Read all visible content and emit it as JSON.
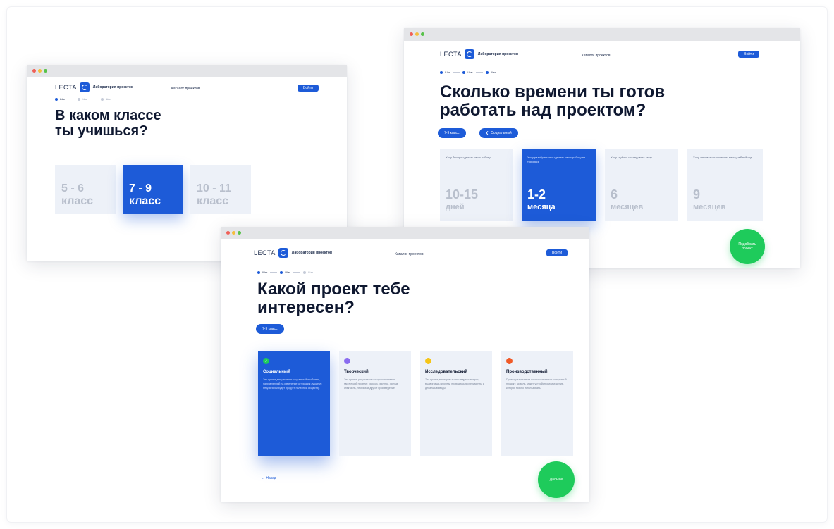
{
  "brand": {
    "logo_text": "LECTA",
    "lab_title": "Лаборатория проектов"
  },
  "nav": {
    "catalog_label": "Каталог проектов",
    "enter_label": "Войти"
  },
  "steps": [
    "Шаг",
    "Шаг",
    "Шаг"
  ],
  "window_grade": {
    "title_line1": "В каком классе",
    "title_line2": "ты учишься?",
    "options": [
      {
        "range": "5 - 6",
        "unit": "класс"
      },
      {
        "range": "7 - 9",
        "unit": "класс"
      },
      {
        "range": "10 - 11",
        "unit": "класс"
      }
    ],
    "selected_index": 1
  },
  "window_time": {
    "title_line1": "Сколько времени ты готов",
    "title_line2": "работать над проектом?",
    "chips": [
      "7-9 класс",
      "Социальный"
    ],
    "options": [
      {
        "note": "Хочу быстро сделать свою работу",
        "value": "10-15",
        "unit": "дней"
      },
      {
        "note": "Хочу разобраться и сделать свою работу не торопясь",
        "value": "1-2",
        "unit": "месяца"
      },
      {
        "note": "Хочу глубоко исследовать тему",
        "value": "6",
        "unit": "месяцев"
      },
      {
        "note": "Хочу заниматься проектом весь учебный год",
        "value": "9",
        "unit": "месяцев"
      }
    ],
    "selected_index": 1,
    "cta_label": "Подобрать проект"
  },
  "window_type": {
    "title_line1": "Какой проект тебе",
    "title_line2": "интересен?",
    "chip": "7-9 класс",
    "options": [
      {
        "name": "Социальный",
        "desc": "Это проект для решения социальной проблемы, направленный на изменение ситуации к лучшему. Результатом будет продукт, полезный обществу.",
        "color": "#1ecb5b"
      },
      {
        "name": "Творческий",
        "desc": "Это проект, результатом которого является творческий продукт: рассказ, рисунок, фильм, спектакль, песня или другое произведение.",
        "color": "#8a6cf0"
      },
      {
        "name": "Исследовательский",
        "desc": "Это проект, в котором ты исследуешь вопрос, выдвигаешь гипотезу, проводишь эксперименты и делаешь выводы.",
        "color": "#f5c518"
      },
      {
        "name": "Производственный",
        "desc": "Проект, результатом которого является конкретный продукт: модель, макет, устройство или изделие, которое можно использовать.",
        "color": "#f05a28"
      }
    ],
    "selected_index": 0,
    "back_label": "← Назад",
    "cta_label": "Дальше"
  },
  "colors": {
    "accent": "#1d5bd8",
    "cta": "#1ecb5b",
    "card_bg": "#edf1f8",
    "title": "#0f1830"
  }
}
